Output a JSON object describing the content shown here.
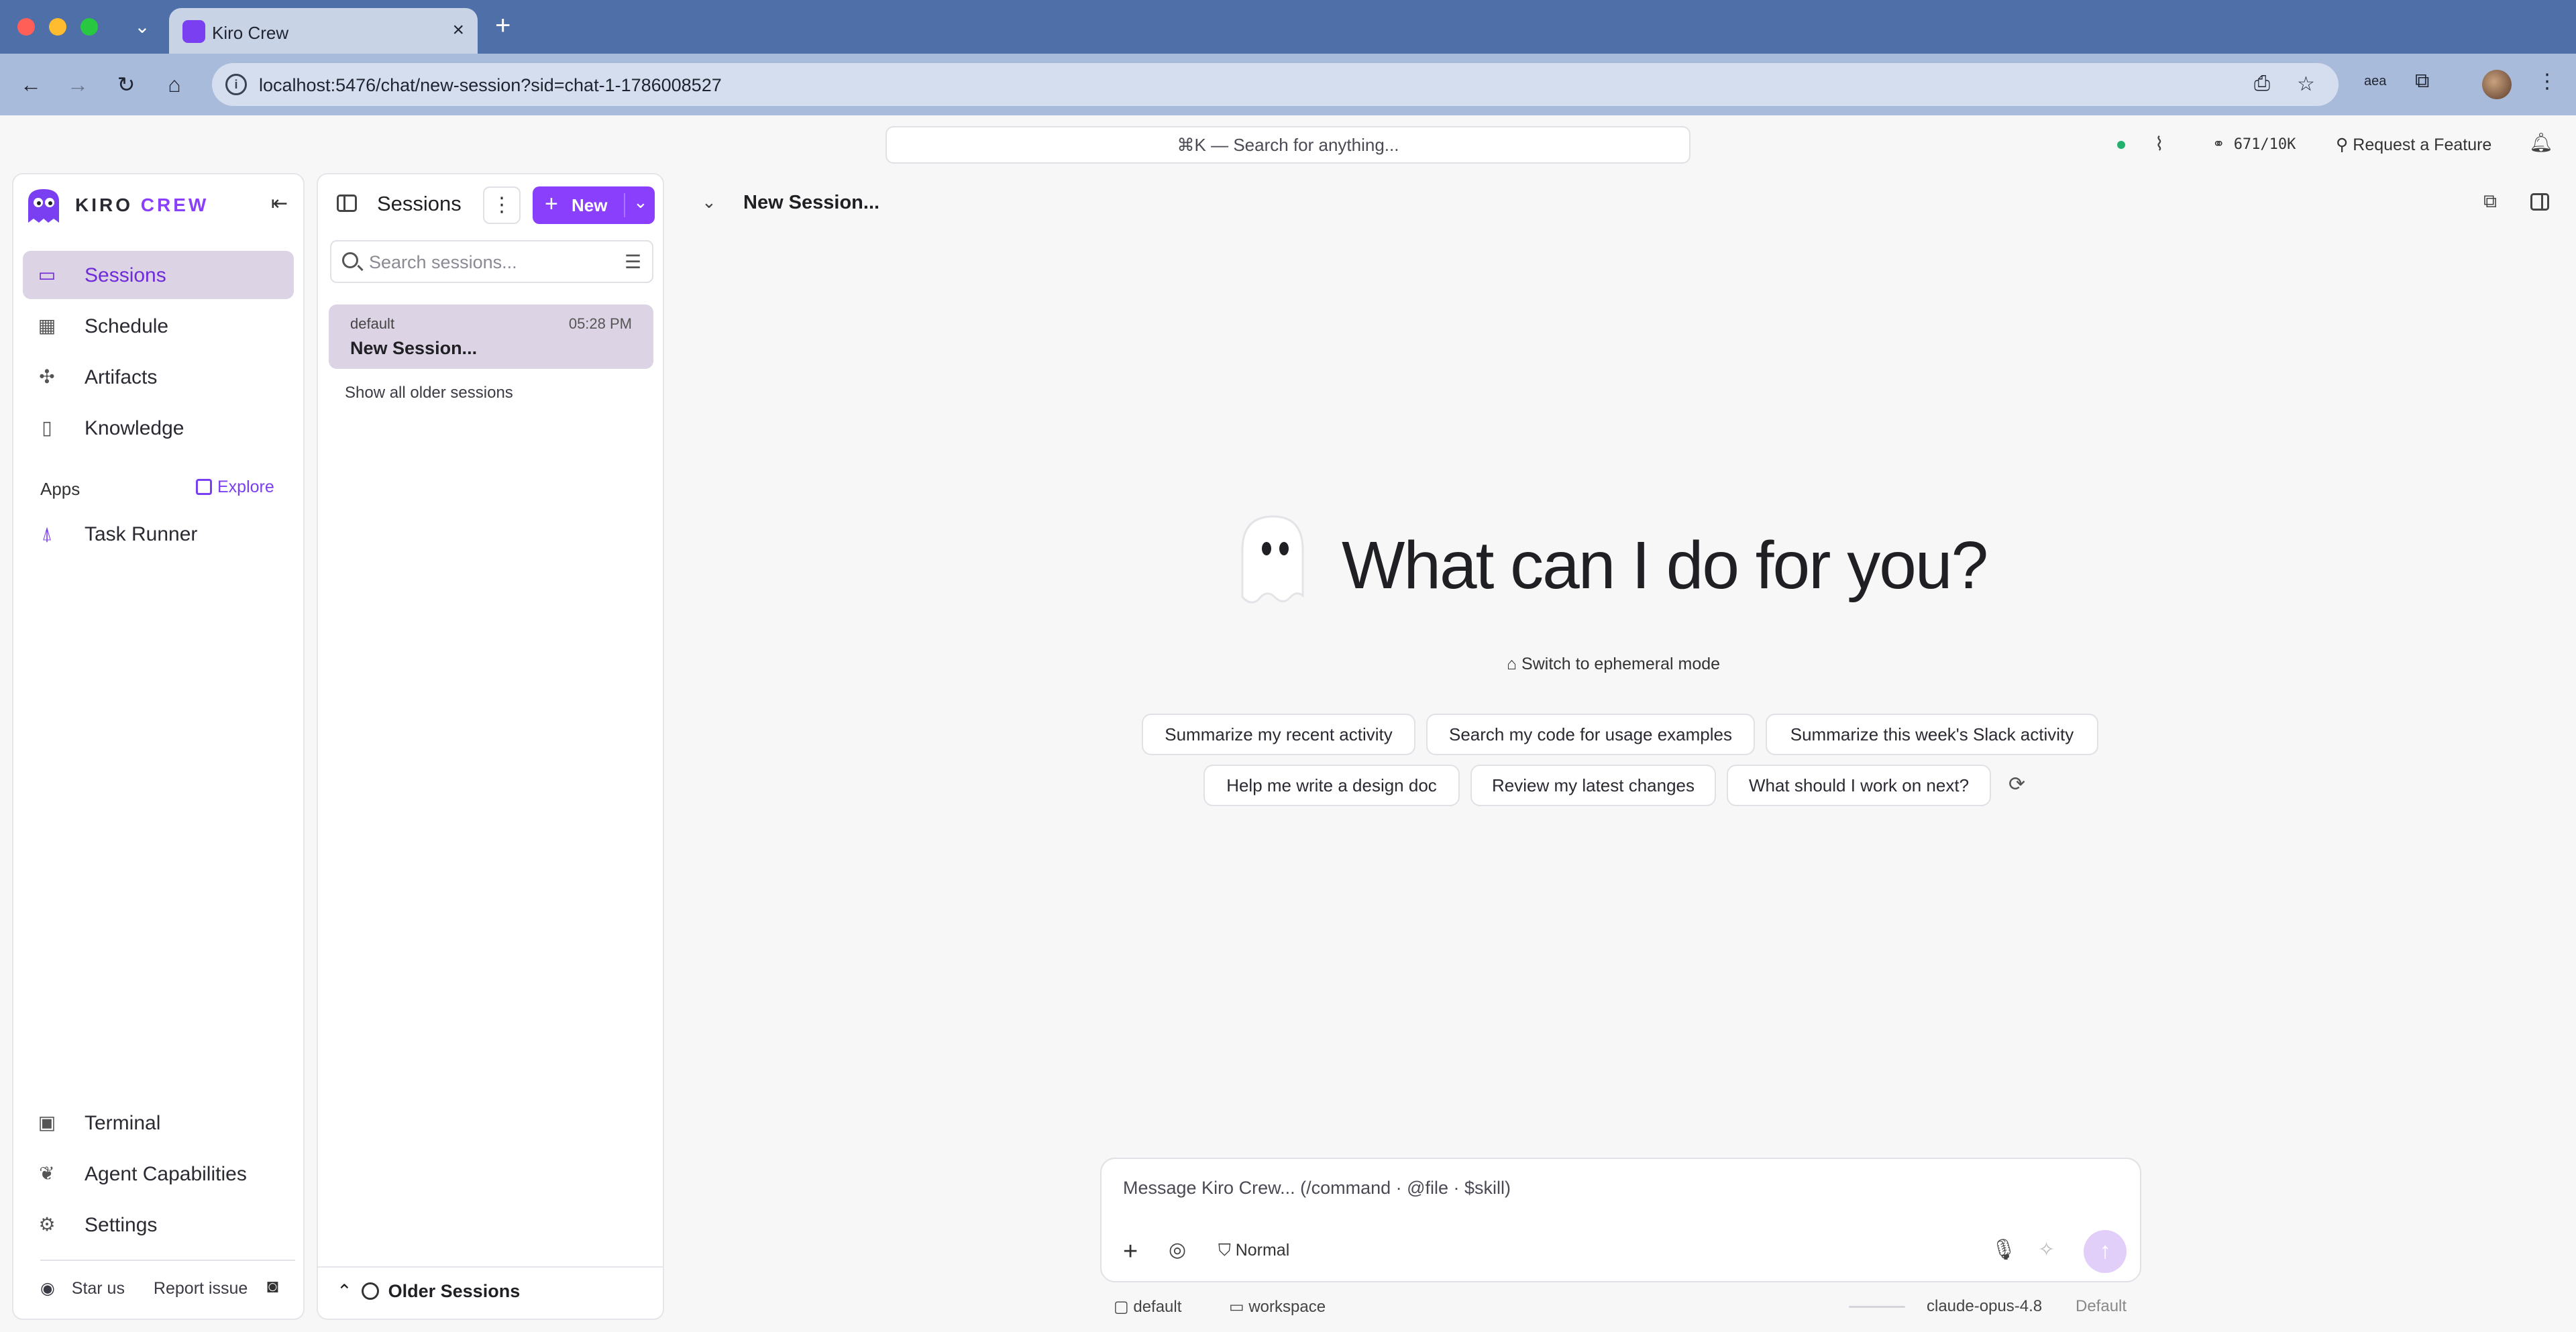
{
  "browser": {
    "tab_title": "Kiro Crew",
    "url": "localhost:5476/chat/new-session?sid=chat-1-1786008527"
  },
  "topbar": {
    "search_hint": "⌘K — Search for anything...",
    "token_usage": "671/10K",
    "request_feature": "Request a Feature"
  },
  "sidebar": {
    "brand_primary": "KIRO",
    "brand_secondary": "CREW",
    "items": [
      {
        "label": "Sessions",
        "icon": "chat-bubble-icon"
      },
      {
        "label": "Schedule",
        "icon": "calendar-icon"
      },
      {
        "label": "Artifacts",
        "icon": "artifacts-icon"
      },
      {
        "label": "Knowledge",
        "icon": "book-icon"
      }
    ],
    "apps_label": "Apps",
    "explore_label": "Explore",
    "apps": [
      {
        "label": "Task Runner",
        "icon": "rocket-icon"
      }
    ],
    "bottom_items": [
      {
        "label": "Terminal",
        "icon": "terminal-icon"
      },
      {
        "label": "Agent Capabilities",
        "icon": "brain-icon"
      },
      {
        "label": "Settings",
        "icon": "gear-icon"
      }
    ],
    "star_us": "Star us",
    "report_issue": "Report issue"
  },
  "sessions_panel": {
    "title": "Sessions",
    "new_label": "New",
    "search_placeholder": "Search sessions...",
    "sessions": [
      {
        "workspace": "default",
        "time": "05:28 PM",
        "title": "New Session..."
      }
    ],
    "show_older": "Show all older sessions",
    "older_sessions": "Older Sessions"
  },
  "main": {
    "title": "New Session...",
    "hero": "What can I do for you?",
    "ephemeral": "Switch to ephemeral mode",
    "suggestions_row1": [
      "Summarize my recent activity",
      "Search my code for usage examples",
      "Summarize this week's Slack activity"
    ],
    "suggestions_row2": [
      "Help me write a design doc",
      "Review my latest changes",
      "What should I work on next?"
    ]
  },
  "composer": {
    "placeholder": "Message Kiro Crew... (/command · @file · $skill)",
    "mode": "Normal",
    "workspace": "default",
    "folder": "workspace",
    "model": "claude-opus-4.8",
    "profile": "Default"
  },
  "colors": {
    "accent": "#8a3ffc",
    "active_bg": "#dcd3e4",
    "tabbar": "#4f6fa8",
    "toolbar": "#a9bbdb"
  }
}
